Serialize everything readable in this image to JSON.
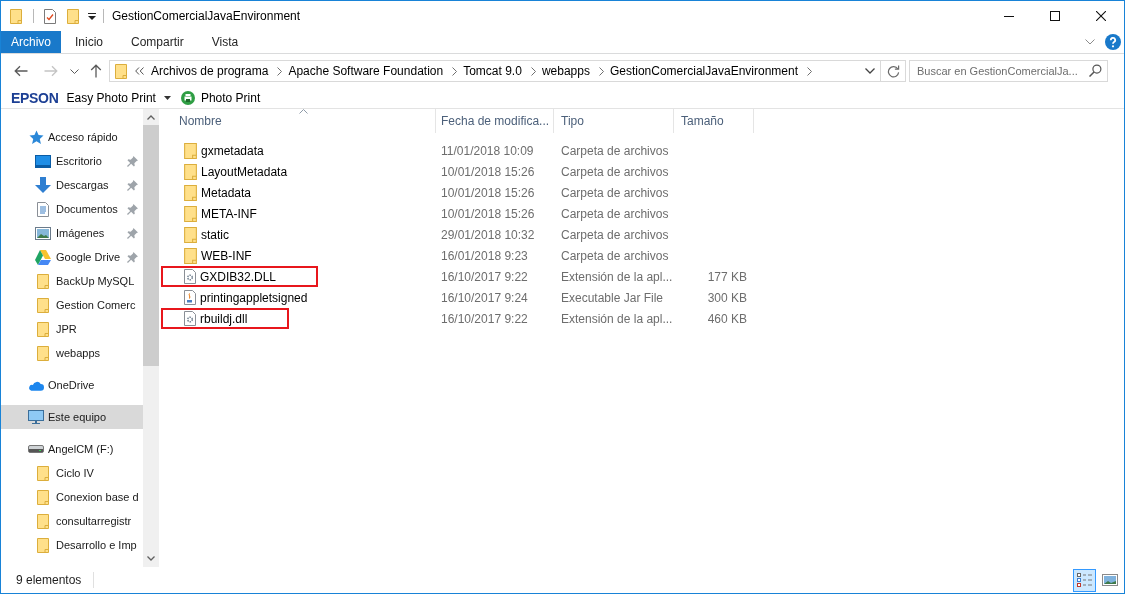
{
  "window": {
    "title": "GestionComercialJavaEnvironment"
  },
  "ribbon": {
    "tabs": [
      {
        "label": "Archivo",
        "selected": true
      },
      {
        "label": "Inicio",
        "selected": false
      },
      {
        "label": "Compartir",
        "selected": false
      },
      {
        "label": "Vista",
        "selected": false
      }
    ]
  },
  "navigation": [
    {
      "kind": "back",
      "disabled": false
    },
    {
      "kind": "forward",
      "disabled": true
    },
    {
      "kind": "recent",
      "disabled": false
    },
    {
      "kind": "up",
      "disabled": false
    }
  ],
  "address_bar": {
    "path": [
      "Archivos de programa",
      "Apache Software Foundation",
      "Tomcat 9.0",
      "webapps",
      "GestionComercialJavaEnvironment"
    ]
  },
  "search": {
    "placeholder": "Buscar en GestionComercialJa..."
  },
  "toolbar": {
    "brand": "EPSON",
    "items": [
      {
        "label": "Easy Photo Print",
        "kind": "dropdown"
      },
      {
        "label": "Photo Print",
        "kind": "printer"
      }
    ]
  },
  "sidebar": {
    "items": [
      {
        "label": "Acceso rápido",
        "kind": "star",
        "selected": false,
        "children": [
          {
            "label": "Escritorio",
            "kind": "desktop",
            "pinned": true,
            "selected": false
          },
          {
            "label": "Descargas",
            "kind": "downloads",
            "pinned": true,
            "selected": false
          },
          {
            "label": "Documentos",
            "kind": "documents",
            "pinned": true,
            "selected": false
          },
          {
            "label": "Imágenes",
            "kind": "pictures",
            "pinned": true,
            "selected": false
          },
          {
            "label": "Google Drive",
            "kind": "drive-logo",
            "pinned": true,
            "selected": false
          },
          {
            "label": "BackUp MySQL",
            "kind": "folder",
            "pinned": false,
            "selected": false
          },
          {
            "label": "Gestion Comerc",
            "kind": "folder",
            "pinned": false,
            "selected": false
          },
          {
            "label": "JPR",
            "kind": "folder",
            "pinned": false,
            "selected": false
          },
          {
            "label": "webapps",
            "kind": "folder",
            "pinned": false,
            "selected": false
          }
        ]
      },
      {
        "label": "OneDrive",
        "kind": "cloud",
        "selected": false
      },
      {
        "label": "Este equipo",
        "kind": "computer",
        "selected": true
      },
      {
        "label": "AngelCM (F:)",
        "kind": "disk",
        "selected": false,
        "children": [
          {
            "label": "Ciclo IV",
            "kind": "folder",
            "pinned": false,
            "selected": false
          },
          {
            "label": "Conexion base d",
            "kind": "folder",
            "pinned": false,
            "selected": false
          },
          {
            "label": "consultarregistr",
            "kind": "folder",
            "pinned": false,
            "selected": false
          },
          {
            "label": "Desarrollo e Imp",
            "kind": "folder",
            "pinned": false,
            "selected": false
          }
        ]
      }
    ]
  },
  "table": {
    "columns": [
      {
        "label": "Nombre",
        "sorted": true
      },
      {
        "label": "Fecha de modifica...",
        "sorted": false
      },
      {
        "label": "Tipo",
        "sorted": false
      },
      {
        "label": "Tamaño",
        "sorted": false
      }
    ],
    "rows": [
      {
        "name": "gxmetadata",
        "date": "11/01/2018 10:09",
        "type": "Carpeta de archivos",
        "kind": "folder",
        "highlighted": false
      },
      {
        "name": "LayoutMetadata",
        "date": "10/01/2018 15:26",
        "type": "Carpeta de archivos",
        "kind": "folder",
        "highlighted": false
      },
      {
        "name": "Metadata",
        "date": "10/01/2018 15:26",
        "type": "Carpeta de archivos",
        "kind": "folder",
        "highlighted": false
      },
      {
        "name": "META-INF",
        "date": "10/01/2018 15:26",
        "type": "Carpeta de archivos",
        "kind": "folder",
        "highlighted": false
      },
      {
        "name": "static",
        "date": "29/01/2018 10:32",
        "type": "Carpeta de archivos",
        "kind": "folder",
        "highlighted": false
      },
      {
        "name": "WEB-INF",
        "date": "16/01/2018 9:23",
        "type": "Carpeta de archivos",
        "kind": "folder",
        "highlighted": false
      },
      {
        "name": "GXDIB32.DLL",
        "date": "16/10/2017 9:22",
        "type": "Extensión de la apl...",
        "size": "177 KB",
        "kind": "dll",
        "highlighted": true
      },
      {
        "name": "printingappletsigned",
        "date": "16/10/2017 9:24",
        "type": "Executable Jar File",
        "size": "300 KB",
        "kind": "jar",
        "highlighted": false
      },
      {
        "name": "rbuildj.dll",
        "date": "16/10/2017 9:22",
        "type": "Extensión de la apl...",
        "size": "460 KB",
        "kind": "dll",
        "highlighted": true
      }
    ]
  },
  "status_bar": {
    "count": "9 elementos",
    "views": [
      {
        "kind": "details",
        "selected": true
      },
      {
        "kind": "large-icons",
        "selected": false
      }
    ]
  }
}
